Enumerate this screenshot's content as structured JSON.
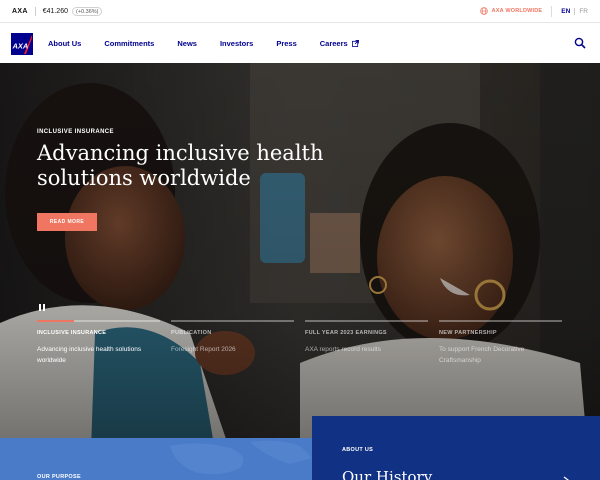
{
  "topbar": {
    "ticker_symbol": "AXA",
    "price": "€41.260",
    "change": "(+0.36%)",
    "worldwide_label": "AXA WORLDWIDE",
    "languages": [
      "EN",
      "FR"
    ]
  },
  "nav": {
    "logo_alt": "AXA",
    "links": [
      "About Us",
      "Commitments",
      "News",
      "Investors",
      "Press",
      "Careers"
    ]
  },
  "hero": {
    "eyebrow": "INCLUSIVE INSURANCE",
    "headline": "Advancing inclusive health solutions worldwide",
    "cta_label": "READ MORE",
    "slides": [
      {
        "title": "INCLUSIVE INSURANCE",
        "desc": "Advancing inclusive health solutions worldwide",
        "active": true
      },
      {
        "title": "PUBLICATION",
        "desc": "Foresight Report 2026",
        "active": false
      },
      {
        "title": "FULL YEAR 2023 EARNINGS",
        "desc": "AXA reports record results",
        "active": false
      },
      {
        "title": "NEW PARTNERSHIP",
        "desc": "To support French Decorative Craftsmanship",
        "active": false
      }
    ]
  },
  "panels": {
    "purpose_label": "OUR PURPOSE",
    "history_label": "ABOUT US",
    "history_title": "Our History"
  },
  "colors": {
    "brand_blue": "#00008f",
    "accent_coral": "#f07662",
    "panel_blue": "#4a7bc8",
    "panel_navy": "#103184"
  },
  "icons": [
    "globe-icon",
    "external-link-icon",
    "search-icon",
    "pause-icon",
    "chevron-right-icon"
  ]
}
